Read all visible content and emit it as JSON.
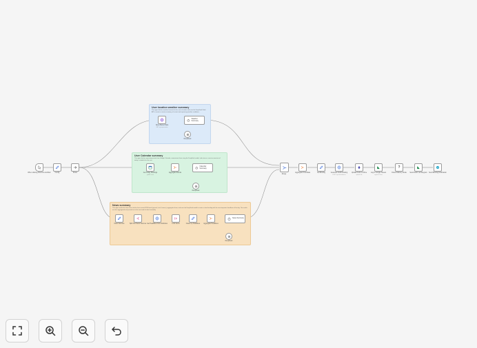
{
  "stickies": {
    "weather": {
      "title": "User location weather summary",
      "desc": "This agent fetches weather forecast for the user's location and uses the DeepSeek Flash API to create a concise summary of current and upcoming weather conditions."
    },
    "calendar": {
      "title": "User Calendar summary",
      "desc": "This agent fetches upcoming events from Google Calendar, summarizes them using the DeepSeek model, and returns a concise overview of today's schedule for the user."
    },
    "news": {
      "title": "News summary",
      "desc": "This agent reads the latest news articles from several RSS feeds (general, tech, finance), aggregates them, and uses the DeepSeek model to create a short briefing with the most important headlines of the day. The results are then aggregated and passed on to the next node for final assembly."
    }
  },
  "nodes": {
    "trigger": {
      "label": "When clicking 'Execute workflow'",
      "icon": "pointer-icon"
    },
    "config": {
      "label": "Config",
      "icon": "pencil-icon"
    },
    "route": {
      "label": "Route",
      "icon": "arrow-right-icon"
    },
    "weather_api": {
      "label": "Open-Meteo Data",
      "sub": "GET: api.open-meteo",
      "icon": "globe-icon"
    },
    "weather_agent": {
      "label": "Weather Summary",
      "icon": "robot-icon"
    },
    "weather_model": {
      "label": "DeepSeek",
      "icon": "model-icon"
    },
    "cal_get": {
      "label": "Get Today Meetings",
      "sub": "getAll: event",
      "icon": "calendar-icon"
    },
    "cal_agg": {
      "label": "Aggregate Events",
      "icon": "aggregate-icon"
    },
    "cal_agent": {
      "label": "Calendar Summary",
      "icon": "robot-icon"
    },
    "cal_model": {
      "label": "DeepSeek",
      "icon": "model-icon"
    },
    "news_sources": {
      "label": "News Sources",
      "icon": "pencil-icon"
    },
    "news_split": {
      "label": "Split Out News Sources",
      "icon": "split-icon"
    },
    "news_rss": {
      "label": "Get Headlines from Websites",
      "icon": "globe-icon"
    },
    "news_limit": {
      "label": "Limit Items",
      "icon": "limit-icon"
    },
    "news_clean": {
      "label": "Clean Up Headlines",
      "icon": "pencil-icon"
    },
    "news_agg": {
      "label": "Aggregate Headlines",
      "icon": "aggregate-icon"
    },
    "news_agent": {
      "label": "News Summary",
      "icon": "robot-icon"
    },
    "news_model": {
      "label": "DeepSeek",
      "icon": "model-icon"
    },
    "merge": {
      "label": "Merge",
      "icon": "merge-icon"
    },
    "agg_final": {
      "label": "Aggregate Final Data",
      "icon": "aggregate-icon"
    },
    "set_briefing": {
      "label": "Set Briefing",
      "icon": "pencil-icon"
    },
    "tts": {
      "label": "Generate Audio Briefing",
      "sub": "POST: api.elevenlabs.io",
      "icon": "globe-icon"
    },
    "upload_drive": {
      "label": "Upload Audio to Drive",
      "sub": "upload: file",
      "icon": "upload-icon"
    },
    "sheet": {
      "label": "Log to Google Sheets",
      "sub": "append: sheet",
      "icon": "sheet-icon"
    },
    "check": {
      "label": "Check Delivery Mode",
      "icon": "question-icon"
    },
    "notify": {
      "label": "Send Audio via Telegram",
      "icon": "sheet-icon"
    },
    "final": {
      "label": "Send Briefing Notification",
      "icon": "circle-icon"
    }
  },
  "controls": {
    "fit": "fit-view-icon",
    "zoom_in": "zoom-in-icon",
    "zoom_out": "zoom-out-icon",
    "undo": "undo-icon"
  },
  "colors": {
    "background": "#f5f5f5",
    "weather_sticky": "#dceaf9",
    "calendar_sticky": "#d8f3e1",
    "news_sticky": "#f8e1bf",
    "connection": "#8c8c8c",
    "accent_orange": "#ea7a2f",
    "accent_blue": "#3f6fd8",
    "accent_green": "#1f8a4c"
  }
}
